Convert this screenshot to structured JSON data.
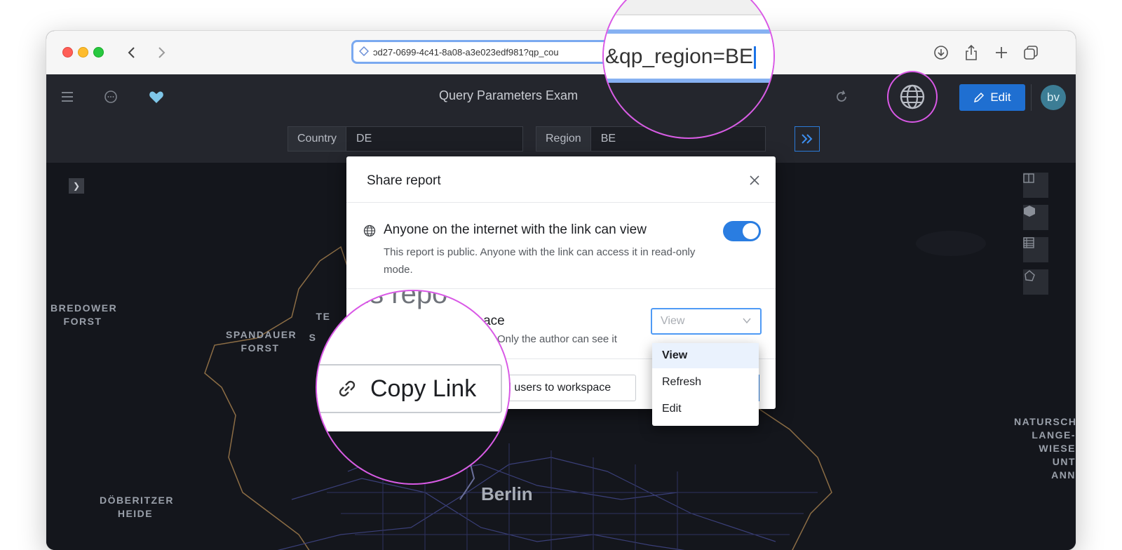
{
  "browser": {
    "url_text": "ɔd27-0699-4c41-8a08-a3e023edf981?qp_cou",
    "url_zoomed_text": "&qp_region=BE"
  },
  "app": {
    "title": "Query Parameters Exam",
    "edit_label": "Edit",
    "avatar_initials": "bv",
    "filters": [
      {
        "label": "Country",
        "value": "DE"
      },
      {
        "label": "Region",
        "value": "BE"
      }
    ]
  },
  "map": {
    "labels": {
      "bredower": "BREDOWER\nFORST",
      "spandauer": "SPANDAUER\nFORST",
      "doberitzer": "DÖBERITZER\nHEIDE",
      "natursch": "NATURSCH\nLANGE-\nWIESE\nUNT\nANN",
      "te": "TE",
      "s": "S"
    },
    "city": "Berlin"
  },
  "modal": {
    "title": "Share report",
    "public_title": "Anyone on the internet with the link can view",
    "public_desc": "This report is public. Anyone with the link can access it in read-only mode.",
    "public_toggle_on": true,
    "workspace_title": "space",
    "workspace_desc": "Only the author can see it",
    "permission_select": "View",
    "permission_options": [
      "View",
      "Refresh",
      "Edit"
    ],
    "add_users_label": "d users to workspace",
    "copy_link_label": "Copy Link",
    "zoom_partial_text": "his repo"
  },
  "colors": {
    "accent": "#2a7de1",
    "callout_ring": "#d958e6",
    "app_bg": "#24262d",
    "map_bg": "#14161c"
  }
}
